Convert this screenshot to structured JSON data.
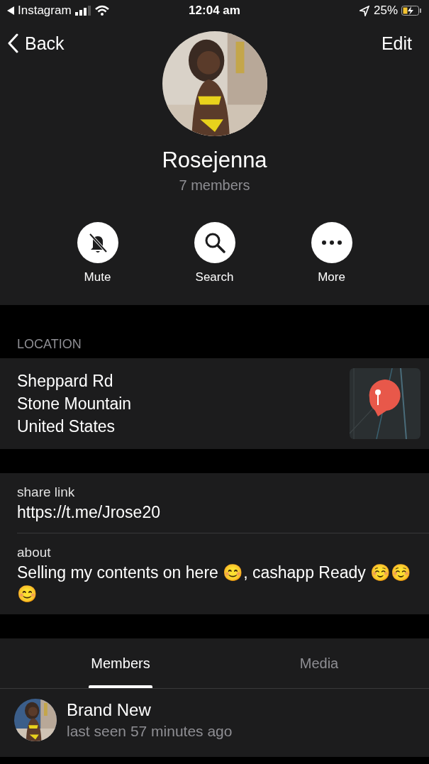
{
  "status_bar": {
    "back_app": "Instagram",
    "time": "12:04 am",
    "battery": "25%",
    "charging": true
  },
  "nav": {
    "back": "Back",
    "edit": "Edit"
  },
  "group": {
    "name": "Rosejenna",
    "members": "7 members"
  },
  "actions": [
    {
      "kind": "mute",
      "label": "Mute"
    },
    {
      "kind": "search",
      "label": "Search"
    },
    {
      "kind": "more",
      "label": "More"
    }
  ],
  "location": {
    "heading": "LOCATION",
    "lines": [
      "Sheppard Rd",
      "Stone Mountain",
      "United States"
    ]
  },
  "info": [
    {
      "label": "share link",
      "value": "https://t.me/Jrose20"
    },
    {
      "label": "about",
      "value": "Selling my contents on here 😊, cashapp Ready ☺️☺️😊"
    }
  ],
  "tabs": [
    {
      "label": "Members",
      "selected": true
    },
    {
      "label": "Media",
      "selected": false
    }
  ],
  "members": [
    {
      "name": "Brand New",
      "status": "last seen 57 minutes ago"
    }
  ]
}
